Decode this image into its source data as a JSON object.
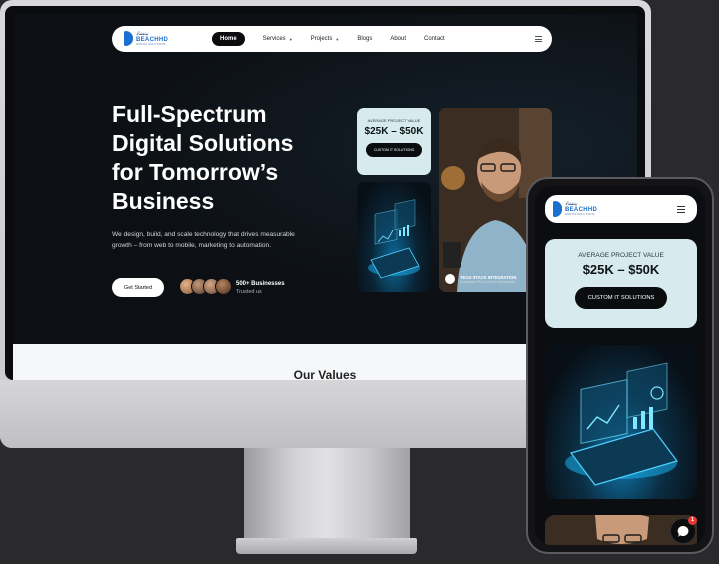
{
  "brand": {
    "name": "BEACHHD",
    "arabic": "بيتشاد",
    "tagline": "DIGITAL SOLUTIONS"
  },
  "nav": {
    "items": [
      {
        "label": "Home",
        "active": true
      },
      {
        "label": "Services",
        "dropdown": true
      },
      {
        "label": "Projects",
        "dropdown": true
      },
      {
        "label": "Blogs"
      },
      {
        "label": "About"
      },
      {
        "label": "Contact"
      }
    ]
  },
  "hero": {
    "title": "Full-Spectrum Digital Solutions for Tomorrow’s Business",
    "description": "We design, build, and scale technology that drives measurable growth – from web to mobile, marketing to automation.",
    "cta_label": "Get Started",
    "businesses_count": "500+ Businesses",
    "businesses_label": "Trusted us"
  },
  "value_card": {
    "label": "AVERAGE PROJECT VALUE",
    "amount": "$25K – $50K",
    "button_label": "CUSTOM IT SOLUTIONS"
  },
  "tech_card": {
    "title": "TECH STACK INTEGRATION",
    "subtitle": "Seamless APIs & Cloud Dashboards"
  },
  "values_section": {
    "title": "Our Values"
  },
  "chat": {
    "badge": "1"
  },
  "colors": {
    "hero_bg": "#0c0f13",
    "card_mint": "#d7ebee",
    "accent_blue": "#1b6fd1",
    "badge_red": "#e53935"
  }
}
